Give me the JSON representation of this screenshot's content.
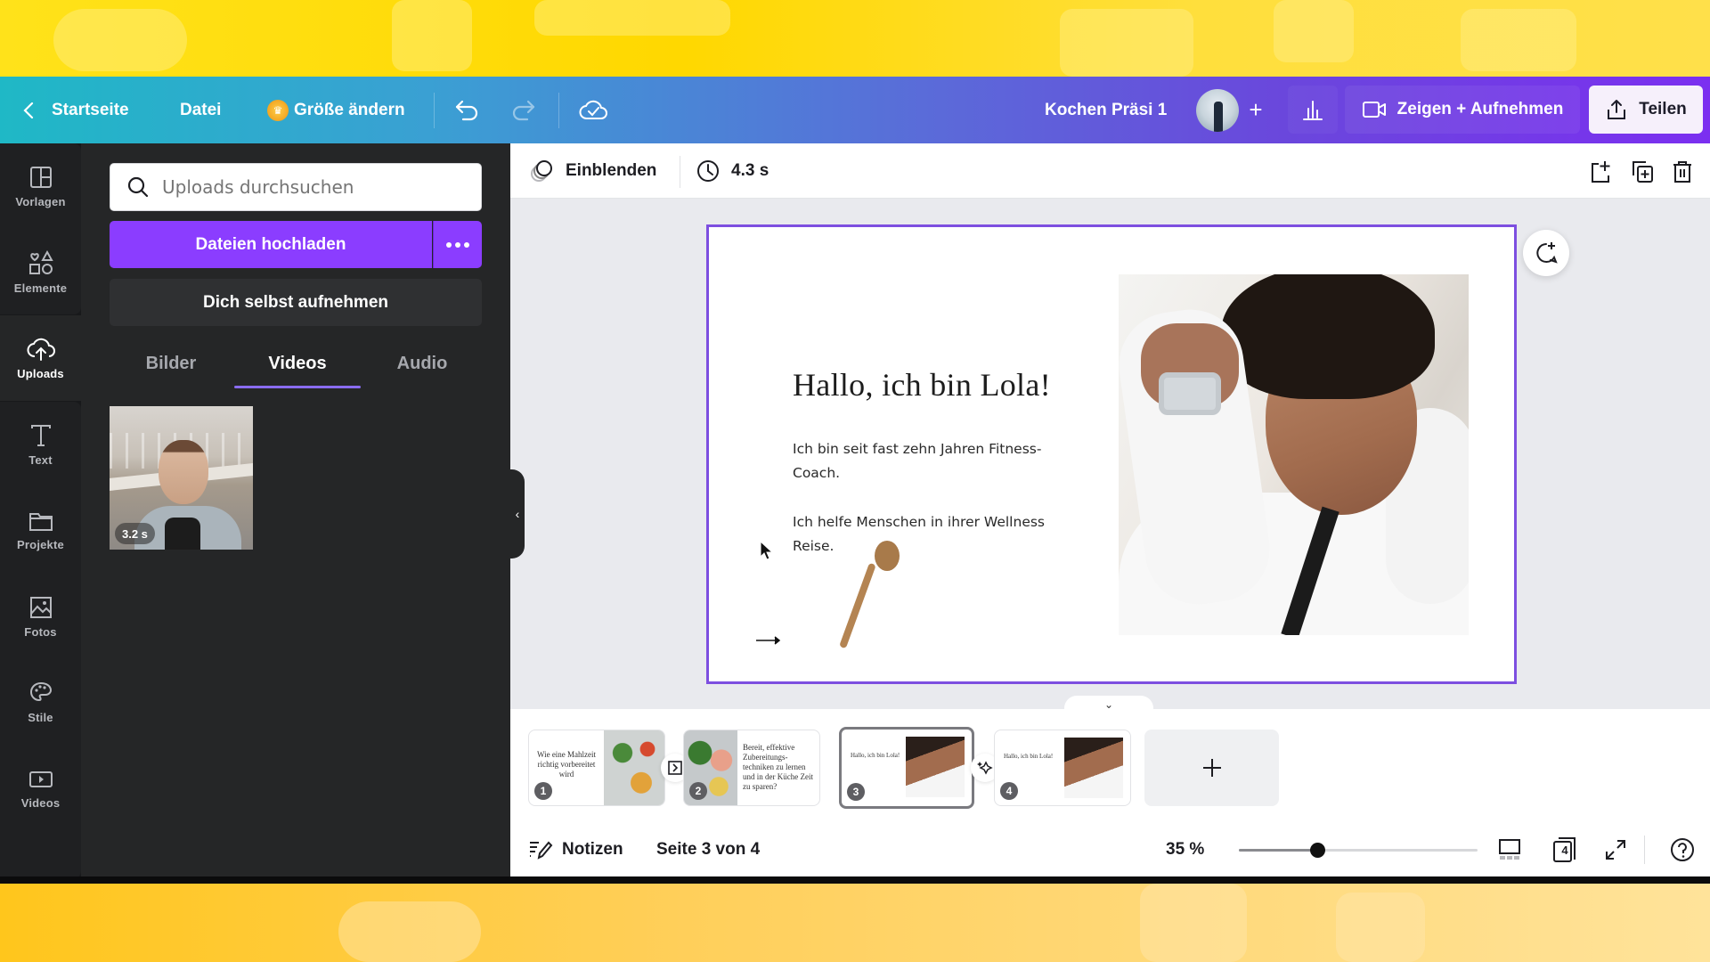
{
  "topbar": {
    "back_label": "Startseite",
    "file_label": "Datei",
    "resize_label": "Größe ändern",
    "doc_title": "Kochen Präsi 1",
    "present_label": "Zeigen + Aufnehmen",
    "share_label": "Teilen",
    "colors": {
      "gradient_start": "#1fb8c6",
      "gradient_end": "#7b2ff0"
    }
  },
  "rail": {
    "items": [
      {
        "label": "Vorlagen",
        "icon": "template-icon"
      },
      {
        "label": "Elemente",
        "icon": "shapes-icon"
      },
      {
        "label": "Uploads",
        "icon": "cloud-upload-icon",
        "active": true
      },
      {
        "label": "Text",
        "icon": "text-icon"
      },
      {
        "label": "Projekte",
        "icon": "folder-icon"
      },
      {
        "label": "Fotos",
        "icon": "image-icon"
      },
      {
        "label": "Stile",
        "icon": "palette-icon"
      },
      {
        "label": "Videos",
        "icon": "video-icon"
      }
    ]
  },
  "panel": {
    "search_placeholder": "Uploads durchsuchen",
    "upload_label": "Dateien hochladen",
    "record_label": "Dich selbst aufnehmen",
    "tabs": [
      {
        "label": "Bilder"
      },
      {
        "label": "Videos",
        "active": true
      },
      {
        "label": "Audio"
      }
    ],
    "videos": [
      {
        "duration": "3.2 s"
      }
    ],
    "accent": "#8b3dff"
  },
  "editbar": {
    "transition_label": "Einblenden",
    "duration_label": "4.3 s"
  },
  "slide": {
    "title": "Hallo, ich bin Lola!",
    "paragraph1": "Ich bin seit fast zehn Jahren Fitness-Coach.",
    "paragraph2": "Ich helfe Menschen in ihrer Wellness Reise."
  },
  "pages": [
    {
      "number": "1",
      "title": "Wie eine Mahlzeit richtig vorbereitet wird"
    },
    {
      "number": "2",
      "title": "Bereit, effektive Zubereitungs-techniken zu lernen und in der Küche Zeit zu sparen?"
    },
    {
      "number": "3",
      "title": "Hallo, ich bin Lola!",
      "active": true
    },
    {
      "number": "4",
      "title": "Hallo, ich bin Lola!"
    }
  ],
  "footer": {
    "notes_label": "Notizen",
    "page_indicator": "Seite 3 von 4",
    "zoom_label": "35 %",
    "zoom_value_percent": 35,
    "page_count_badge": "4"
  }
}
